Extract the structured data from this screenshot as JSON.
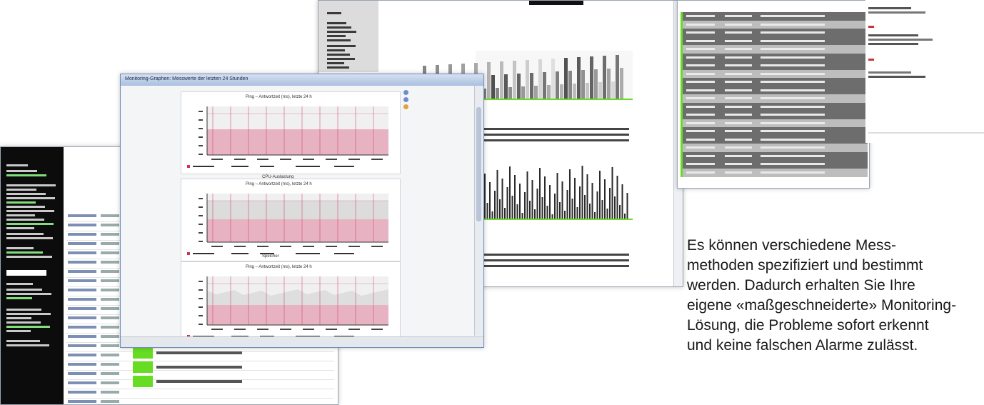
{
  "front_window": {
    "title": "Monitoring-Graphen: Messwerte der letzten 24 Stunden",
    "panels": [
      {
        "title": "Ping – Antwortzeit (ms), letzte 24 h",
        "label": "CPU-Auslastung"
      },
      {
        "title": "Ping – Antwortzeit (ms), letzte 24 h",
        "label": "Speicher"
      },
      {
        "title": "Ping – Antwortzeit (ms), letzte 24 h",
        "label": ""
      }
    ],
    "icons": [
      "zoom-icon",
      "refresh-icon",
      "settings-icon"
    ]
  },
  "caption": {
    "lines": [
      "Es können verschiedene Mess-",
      "methoden spezifiziert und bestimmt",
      "werden. Dadurch erhalten Sie Ihre",
      "eigene «maßgeschneiderte» Monitoring-",
      "Lösung, die Probleme sofort erkennt",
      "und keine falschen Alarme zulässt."
    ]
  },
  "colors": {
    "status_ok": "#66dd22",
    "graph_band": "#e7b3c2",
    "graph_line": "#cc3355",
    "sidebar_bg": "#0c0c0c",
    "titlebar": "#a9bedf"
  }
}
